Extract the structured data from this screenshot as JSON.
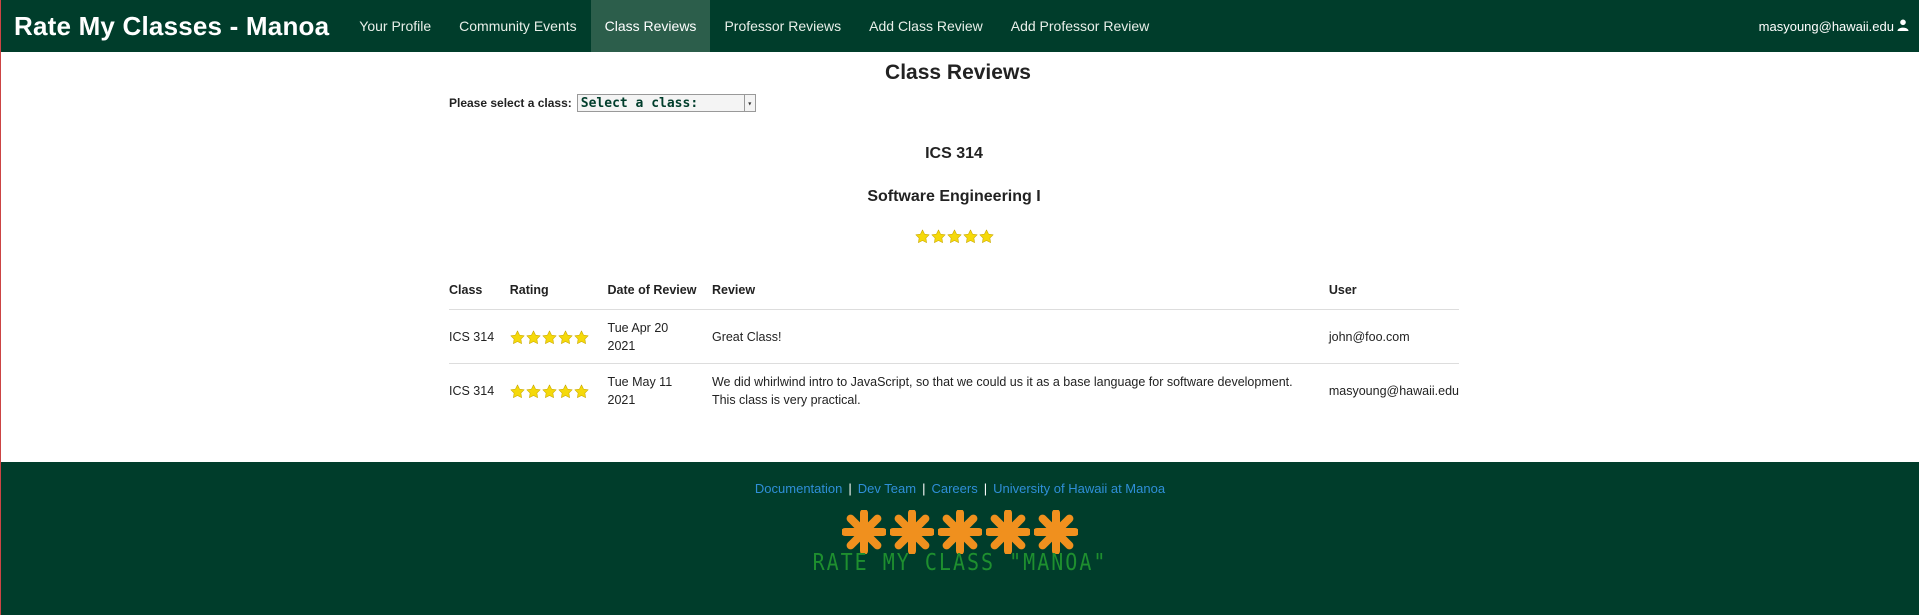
{
  "nav": {
    "brand": "Rate My Classes - Manoa",
    "items": [
      {
        "label": "Your Profile"
      },
      {
        "label": "Community Events"
      },
      {
        "label": "Class Reviews"
      },
      {
        "label": "Professor Reviews"
      },
      {
        "label": "Add Class Review"
      },
      {
        "label": "Add Professor Review"
      }
    ],
    "active_item": "Class Reviews",
    "user": "masyoung@hawaii.edu",
    "user_icon": "user-icon"
  },
  "page": {
    "title": "Class Reviews",
    "select_label": "Please select a class:",
    "select_value": "Select a class:"
  },
  "class_summary": {
    "code": "ICS 314",
    "name": "Software Engineering I",
    "rating": 5
  },
  "reviews": {
    "headers": [
      "Class",
      "Rating",
      "Date of Review",
      "Review",
      "User"
    ],
    "rows": [
      {
        "class": "ICS 314",
        "rating": 5,
        "date": "Tue Apr 20 2021",
        "review": "Great Class!",
        "user": "john@foo.com"
      },
      {
        "class": "ICS 314",
        "rating": 5,
        "date": "Tue May 11 2021",
        "review": "We did whirlwind intro to JavaScript, so that we could us it as a base language for software development. This class is very practical.",
        "user": "masyoung@hawaii.edu"
      }
    ]
  },
  "footer": {
    "links": [
      "Documentation",
      "Dev Team",
      "Careers",
      "University of Hawaii at Manoa"
    ],
    "separator": "|",
    "logo_text": "RATE MY CLASS \"MANOA\""
  },
  "colors": {
    "navbar": "#003d2b",
    "active_nav": "#2c5e4b",
    "star": "#f5d90a",
    "logo_star": "#f0901e",
    "link": "#2f8fd8"
  }
}
